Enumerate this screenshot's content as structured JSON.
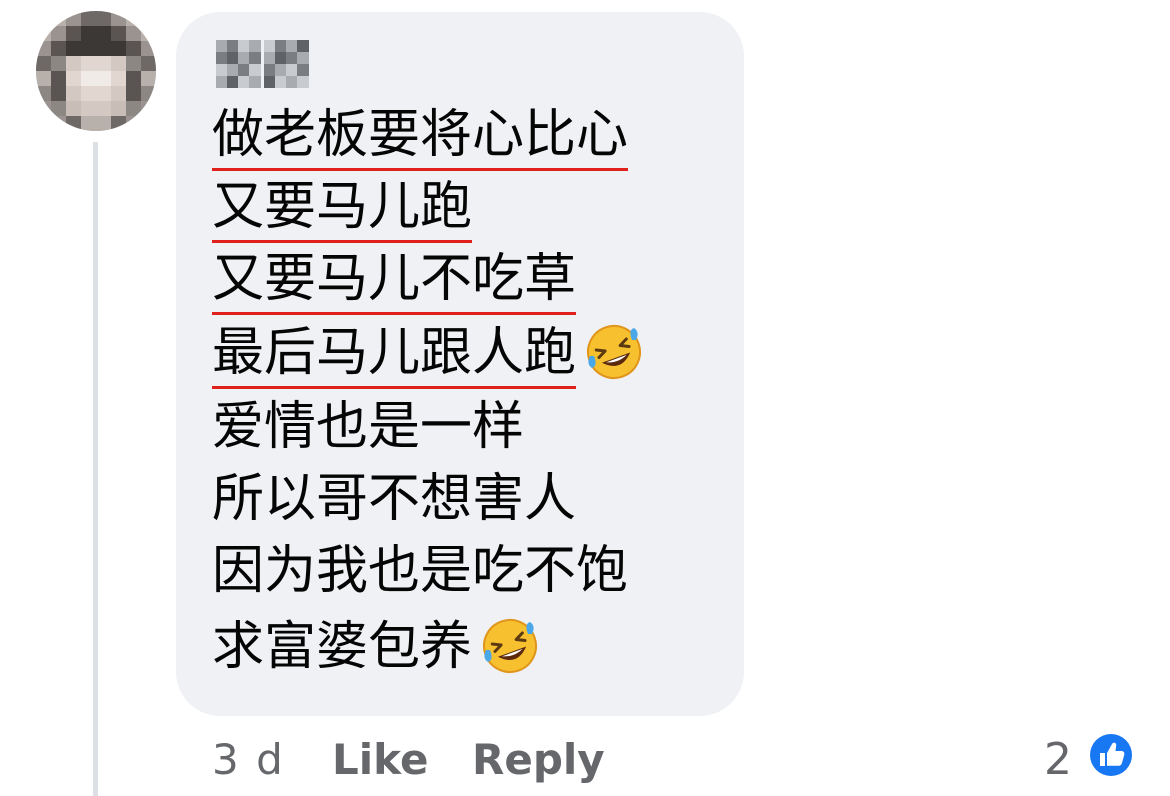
{
  "comment": {
    "author": "青柯",
    "lines": [
      {
        "text": "做老板要将心比心",
        "underlined": true,
        "emoji": false
      },
      {
        "text": "又要马儿跑",
        "underlined": true,
        "emoji": false
      },
      {
        "text": "又要马儿不吃草",
        "underlined": true,
        "emoji": false
      },
      {
        "text": "最后马儿跟人跑",
        "underlined": true,
        "emoji": true
      },
      {
        "text": "爱情也是一样",
        "underlined": false,
        "emoji": false
      },
      {
        "text": "所以哥不想害人",
        "underlined": false,
        "emoji": false
      },
      {
        "text": "因为我也是吃不饱",
        "underlined": false,
        "emoji": false
      },
      {
        "text": "求富婆包养",
        "underlined": false,
        "emoji": true
      }
    ],
    "emoji_name": "rolling-on-the-floor-laughing-emoji",
    "underline_color": "#e0201a"
  },
  "footer": {
    "time": "3 d",
    "like_label": "Like",
    "reply_label": "Reply",
    "reaction_count": "2",
    "reaction_icon": "thumbs-up-icon"
  },
  "colors": {
    "bubble": "#eff1f4",
    "text": "#050505",
    "secondary_text": "#65676b",
    "like_blue": "#1877f2"
  }
}
